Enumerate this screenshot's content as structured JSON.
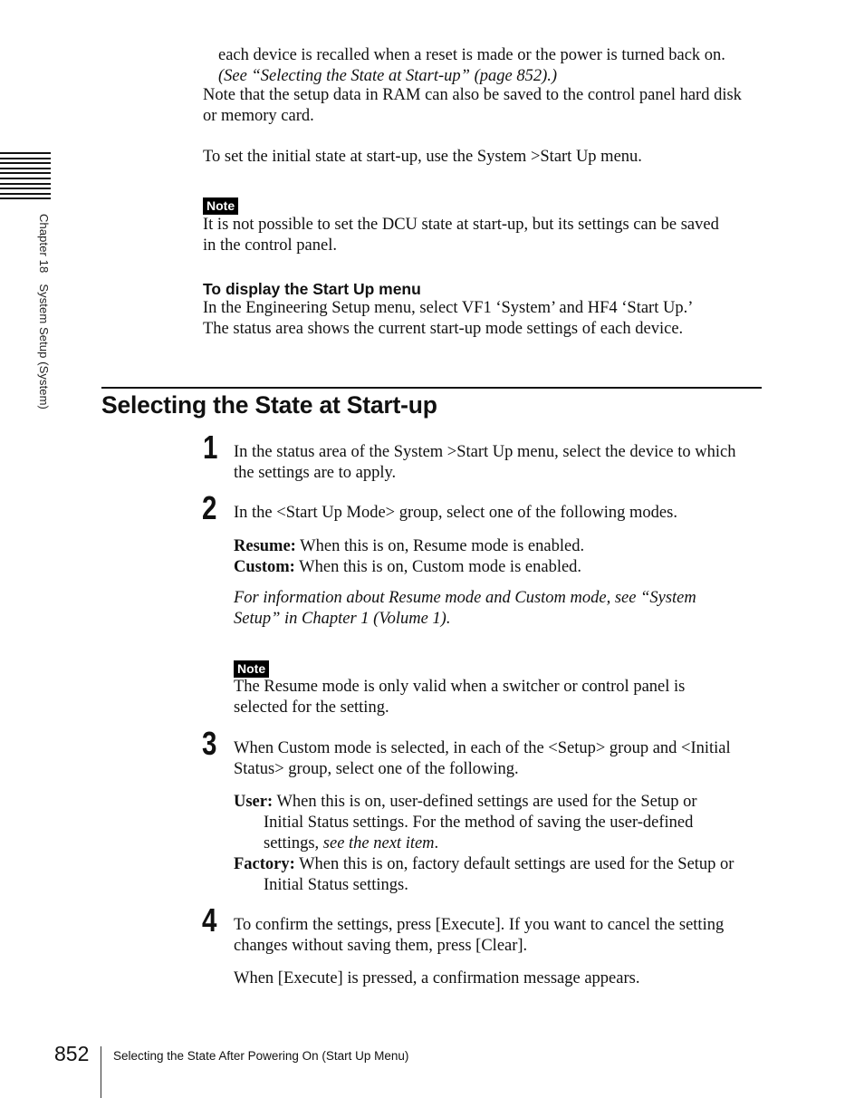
{
  "side_tab": {
    "chapter": "Chapter 18",
    "section": "System Setup (System)"
  },
  "top": {
    "continued_line": "each device is recalled when a reset is made or the power is turned back on.",
    "continued_ref": "(See “Selecting the State at Start-up” (page 852).)",
    "para1_lines": [
      "Note that the setup data in RAM can also be saved to the control panel hard disk",
      "or memory card."
    ],
    "para2": "To set the initial state at start-up, use the System >Start Up menu.",
    "note": {
      "badge": "Note",
      "lines": [
        "It is not possible to set the DCU state at start-up, but its settings can be saved",
        "in the control panel."
      ]
    },
    "subheading": "To display the Start Up menu",
    "sub_lines": [
      "In the Engineering Setup menu, select VF1 ‘System’ and HF4 ‘Start Up.’",
      "The status area shows the current start-up mode settings of each device."
    ]
  },
  "section": {
    "title": "Selecting the State at Start-up",
    "steps": [
      {
        "number": "1",
        "lines": [
          "In the status area of the System >Start Up menu, select the device to which",
          "the settings are to apply."
        ]
      },
      {
        "number": "2",
        "lines": [
          "In the <Start Up Mode> group, select one of the following modes."
        ],
        "options": [
          {
            "term": "Resume:",
            "desc": "When this is on, Resume mode is enabled."
          },
          {
            "term": "Custom:",
            "desc": "When this is on, Custom mode is enabled."
          }
        ],
        "ref_lines": [
          "For information about Resume mode and Custom mode, see “System",
          "Setup” in Chapter 1 (Volume 1)."
        ],
        "note": {
          "badge": "Note",
          "lines": [
            "The Resume mode is only valid when a switcher or control panel is",
            "selected for the setting."
          ]
        }
      },
      {
        "number": "3",
        "lines": [
          "When Custom mode is selected, in each of the <Setup> group and <Initial",
          "Status> group, select one of the following."
        ],
        "options": [
          {
            "term": "User:",
            "desc_first": "When this is on, user-defined settings are used for the Setup or",
            "desc_rest": [
              "Initial Status settings. For the method of saving the user-defined"
            ],
            "desc_last_plain": "settings, ",
            "desc_last_italic": "see the next item",
            "desc_last_end": "."
          },
          {
            "term": "Factory:",
            "desc_first": "When this is on, factory default settings are used for the Setup or",
            "desc_rest": [
              "Initial Status settings."
            ]
          }
        ]
      },
      {
        "number": "4",
        "lines": [
          "To confirm the settings, press [Execute]. If you want to cancel the setting",
          "changes without saving them, press [Clear]."
        ],
        "after": "When [Execute] is pressed, a confirmation message appears."
      }
    ]
  },
  "footer": {
    "page_number": "852",
    "title": "Selecting the State After Powering On (Start Up Menu)"
  }
}
